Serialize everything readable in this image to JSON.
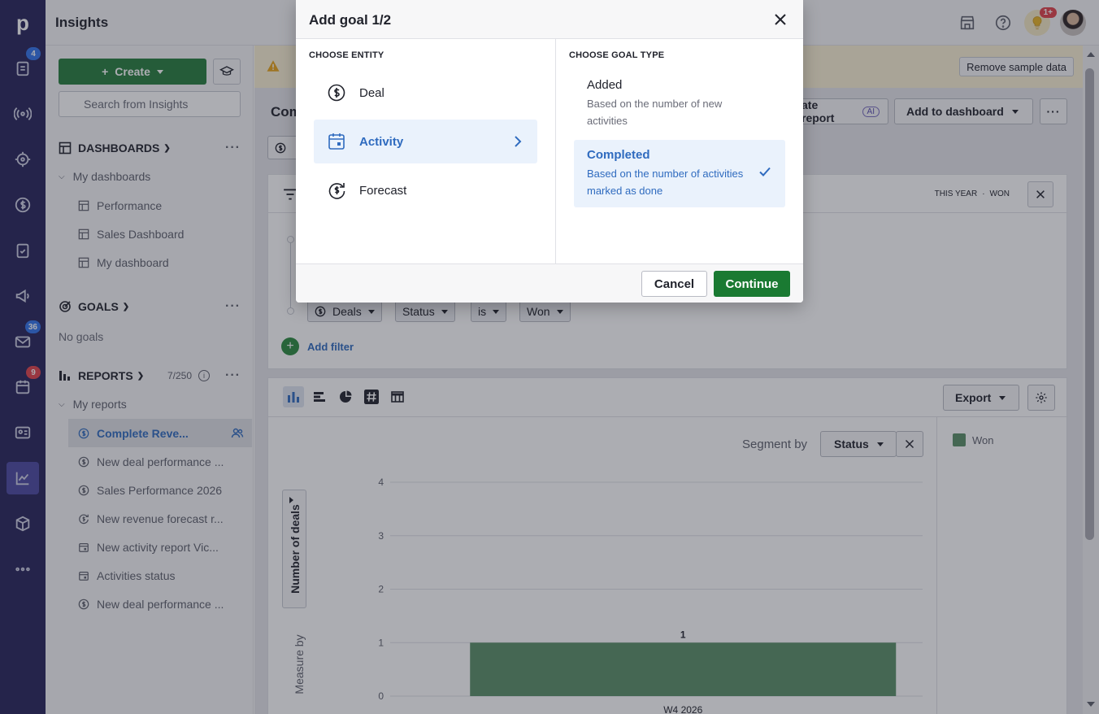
{
  "app": {
    "title": "Insights"
  },
  "rail": {
    "logo": "p",
    "badges": {
      "leads": "4",
      "mail": "36",
      "calendar": "9"
    }
  },
  "topbar": {
    "notification_badge": "1+"
  },
  "sidebar": {
    "create_label": "Create",
    "search_placeholder": "Search from Insights",
    "dashboards": {
      "heading": "DASHBOARDS",
      "group": "My dashboards",
      "items": [
        "Performance",
        "Sales Dashboard",
        "My dashboard"
      ]
    },
    "goals": {
      "heading": "GOALS",
      "empty": "No goals"
    },
    "reports": {
      "heading": "REPORTS",
      "count": "7/250",
      "group": "My reports",
      "items": [
        "Complete Reve...",
        "New deal performance ...",
        "Sales Performance 2026",
        "New revenue forecast r...",
        "New activity report Vic...",
        "Activities status",
        "New deal performance ..."
      ]
    }
  },
  "main": {
    "warn_action": "Remove sample data",
    "report_title_prefix": "Com",
    "generate_label": "ate report",
    "ai_badge": "AI",
    "add_dashboard_label": "Add to dashboard",
    "filter_summary": [
      "THIS YEAR",
      "WON"
    ],
    "filters": {
      "entity": "Deals",
      "field": "Status",
      "op": "is",
      "value": "Won"
    },
    "add_filter": "Add filter",
    "export_label": "Export",
    "segment_label": "Segment by",
    "segment_value": "Status",
    "measure_label": "Measure by",
    "legend": [
      {
        "name": "Won",
        "color": "#5a8f66"
      }
    ]
  },
  "chart_data": {
    "type": "bar",
    "categories": [
      "W4 2026"
    ],
    "series": [
      {
        "name": "Won",
        "values": [
          1
        ]
      }
    ],
    "ylabel": "Number of deals",
    "ylim": [
      0,
      4
    ],
    "yticks": [
      0,
      1,
      2,
      3,
      4
    ],
    "data_labels": [
      "1"
    ],
    "grid": true
  },
  "modal": {
    "title": "Add goal 1/2",
    "entity_heading": "CHOOSE ENTITY",
    "entities": [
      {
        "label": "Deal",
        "icon": "dollar-circle-icon"
      },
      {
        "label": "Activity",
        "icon": "calendar-icon",
        "selected": true
      },
      {
        "label": "Forecast",
        "icon": "forecast-icon"
      }
    ],
    "goal_type_heading": "CHOOSE GOAL TYPE",
    "goal_types": [
      {
        "label": "Added",
        "desc": "Based on the number of new activities"
      },
      {
        "label": "Completed",
        "desc": "Based on the number of activities marked as done",
        "selected": true
      }
    ],
    "cancel_label": "Cancel",
    "continue_label": "Continue",
    "accent": "#2f6bbf",
    "primary": "#1a7a32"
  }
}
